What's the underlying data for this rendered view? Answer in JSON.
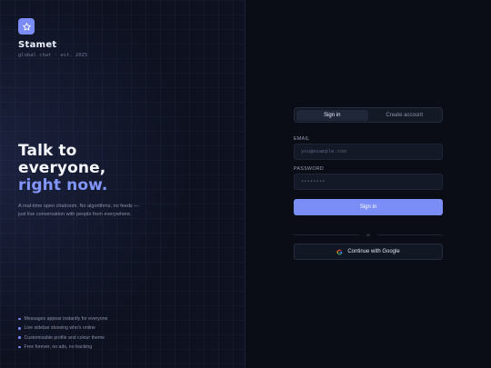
{
  "brand": {
    "name": "Stamet",
    "tagline": "global chat · est. 2025",
    "logo_icon": "star-icon",
    "accent_color": "#7b8cf7"
  },
  "hero": {
    "headline_line1": "Talk to",
    "headline_line2": "everyone,",
    "headline_accent": "right now.",
    "intro": "A real-time open chatroom. No algorithms, no feeds — just live conversation with people from everywhere."
  },
  "features": [
    "Messages appear instantly for everyone",
    "Live sidebar showing who's online",
    "Customisable profile and colour theme",
    "Free forever, no ads, no tracking"
  ],
  "auth": {
    "tabs": [
      "Sign in",
      "Create account"
    ],
    "active_tab": "Sign in",
    "email_label": "EMAIL",
    "email_placeholder": "you@example.com",
    "password_label": "PASSWORD",
    "password_placeholder": "••••••••",
    "submit_label": "Sign in",
    "divider_text": "or",
    "google_label": "Continue with Google",
    "google_icon": "google-icon"
  }
}
